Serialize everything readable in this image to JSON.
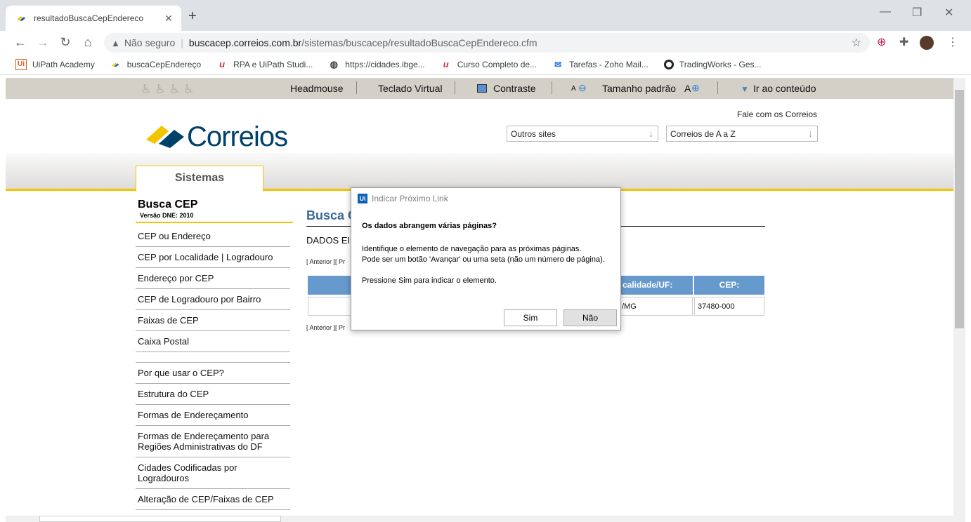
{
  "browser": {
    "tab_title": "resultadoBuscaCepEndereco",
    "url_security": "Não seguro",
    "url_host": "buscacep.correios.com.br",
    "url_path": "/sistemas/buscacep/resultadoBuscaCepEndereco.cfm",
    "bookmarks": [
      {
        "label": "UiPath Academy",
        "icon": "uipath-icon"
      },
      {
        "label": "buscaCepEndereço",
        "icon": "correios-icon"
      },
      {
        "label": "RPA e UiPath Studi...",
        "icon": "udemy-icon"
      },
      {
        "label": "https://cidades.ibge...",
        "icon": "globe-icon"
      },
      {
        "label": "Curso Completo de...",
        "icon": "udemy-icon"
      },
      {
        "label": "Tarefas - Zoho Mail...",
        "icon": "zoho-icon"
      },
      {
        "label": "TradingWorks - Ges...",
        "icon": "tradingworks-icon"
      }
    ]
  },
  "accessibility": {
    "headmouse": "Headmouse",
    "teclado": "Teclado Virtual",
    "contraste": "Contraste",
    "a_small": "A",
    "tamanho": "Tamanho padrão",
    "a_big": "A",
    "ir": "Ir ao conteúdo"
  },
  "header": {
    "logo_text": "Correios",
    "fale": "Fale com os Correios",
    "select1": "Outros sites",
    "select2": "Correios de A a Z",
    "systab": "Sistemas"
  },
  "sidebar": {
    "title": "Busca CEP",
    "version": "Versão DNE: 2010",
    "items": [
      "CEP ou Endereço",
      "CEP por Localidade | Logradouro",
      "Endereço por CEP",
      "CEP de Logradouro por Bairro",
      "Faixas de CEP",
      "Caixa Postal"
    ],
    "items2": [
      "Por que usar o CEP?",
      "Estrutura do CEP",
      "Formas de Endereçamento",
      "Formas de Endereçamento para Regiões Administrativas do DF",
      "Cidades Codificadas por Logradouros",
      "Alteração de CEP/Faixas de CEP"
    ]
  },
  "main": {
    "title": "Busca C",
    "dados": "DADOS EI",
    "pager_top": "[ Anterior ][ Pr",
    "pager_bottom": "[ Anterior ][ Pr",
    "col_localidade": "calidade/UF:",
    "col_cep": "CEP:",
    "cell_localidade": "/MG",
    "cell_cep": "37480-000"
  },
  "dialog": {
    "app_icon": "Ui",
    "title": "Indicar Próximo Link",
    "question": "Os dados abrangem várias páginas?",
    "body": "Identifique o elemento de navegação para as próximas páginas.\nPode ser um botão 'Avançar' ou uma seta (não um número de página).\n\nPressione Sim para indicar o elemento.",
    "yes": "Sim",
    "no": "Não"
  }
}
